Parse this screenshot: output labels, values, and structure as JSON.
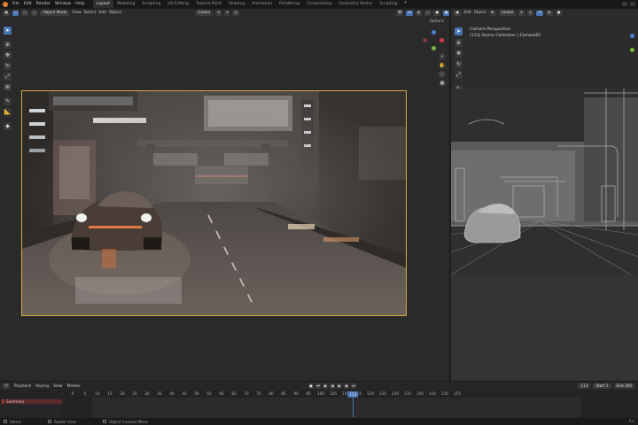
{
  "topbar": {
    "menus": [
      "File",
      "Edit",
      "Render",
      "Window",
      "Help"
    ],
    "workspaces": [
      "Layout",
      "Modeling",
      "Sculpting",
      "UV Editing",
      "Texture Paint",
      "Shading",
      "Animation",
      "Rendering",
      "Compositing",
      "Geometry Nodes",
      "Scripting"
    ],
    "add_label": "+"
  },
  "left_view": {
    "mode": "Object Mode",
    "menus": [
      "View",
      "Select",
      "Add",
      "Object"
    ],
    "transform": "Global",
    "options": "Options"
  },
  "right_view": {
    "menus": [
      "Add",
      "Object"
    ],
    "transform": "Global",
    "camera_title": "Camera Perspective",
    "collection_line": "(113) Scene Collection | Camera01"
  },
  "timeline": {
    "menus": [
      "Playback",
      "Keying",
      "View",
      "Marker"
    ],
    "ticks": [
      "0",
      "5",
      "10",
      "15",
      "20",
      "25",
      "30",
      "35",
      "40",
      "45",
      "50",
      "55",
      "60",
      "65",
      "70",
      "75",
      "80",
      "85",
      "90",
      "95",
      "100",
      "105",
      "110",
      "115",
      "120",
      "125",
      "130",
      "135",
      "140",
      "145",
      "150",
      "155"
    ],
    "current_frame": "113",
    "current_field": "113",
    "start_label": "Start",
    "start_value": "1",
    "end_label": "End",
    "end_value": "160",
    "summary_label": "Summary"
  },
  "statusbar": {
    "items": [
      "Select",
      "Rotate View",
      "Object Context Menu"
    ],
    "version": "3.x"
  },
  "colors": {
    "accent": "#4772b3",
    "frame_border": "#d6a93b",
    "logo": "#e0813a"
  }
}
